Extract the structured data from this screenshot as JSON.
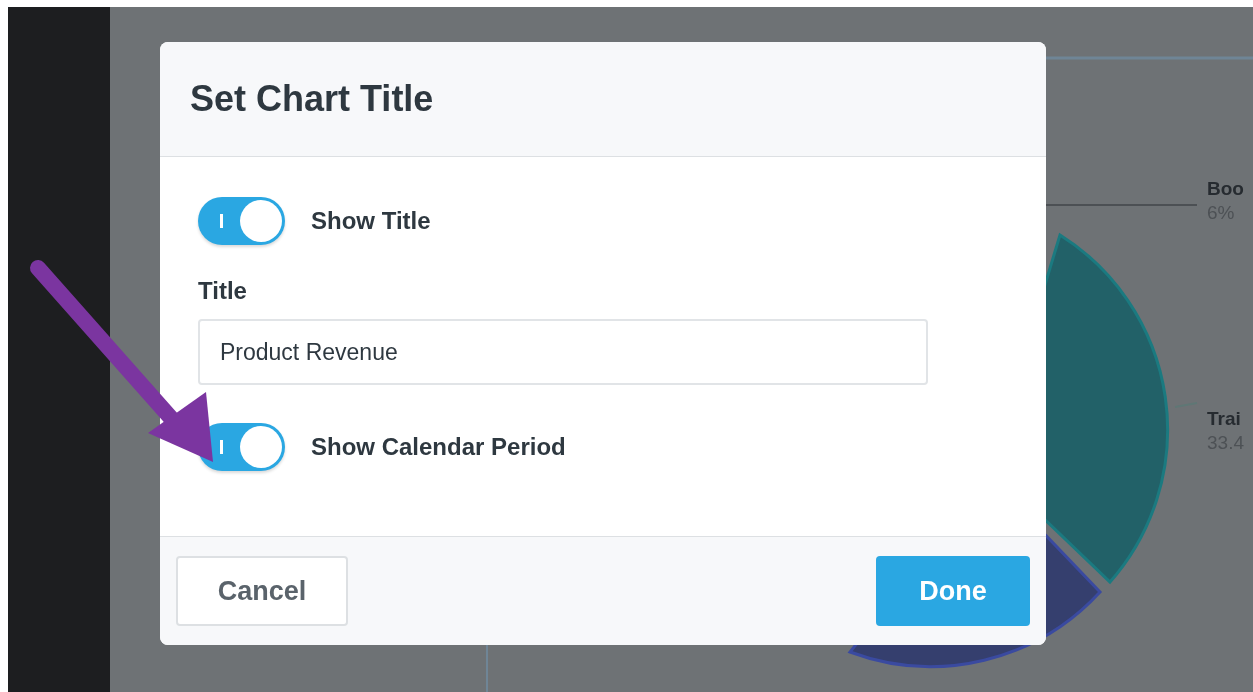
{
  "background": {
    "chart_labels": [
      {
        "name": "Boo",
        "value": "6%"
      },
      {
        "name": "Trai",
        "value": "33.4"
      }
    ]
  },
  "dialog": {
    "title": "Set Chart Title",
    "fields": [
      {
        "kind": "toggle",
        "label": "Show Title",
        "on": true
      },
      {
        "kind": "text",
        "label": "Title",
        "value": "Product Revenue"
      },
      {
        "kind": "toggle",
        "label": "Show Calendar Period",
        "on": true
      }
    ],
    "buttons": [
      {
        "kind": "secondary",
        "label": "Cancel"
      },
      {
        "kind": "primary",
        "label": "Done"
      }
    ]
  }
}
